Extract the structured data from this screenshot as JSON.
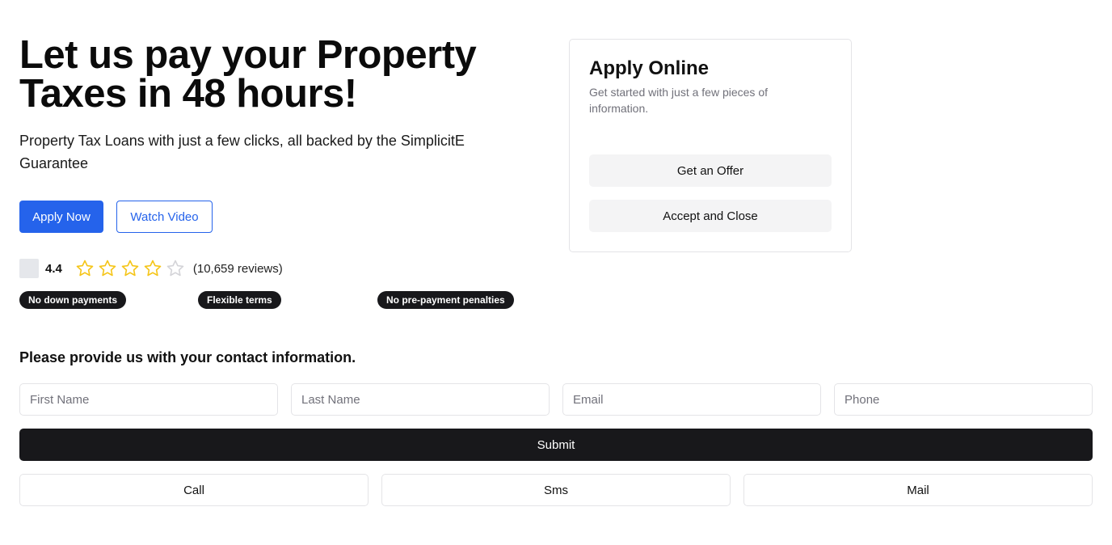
{
  "hero": {
    "title": "Let us pay your Property Taxes in 48 hours!",
    "subtitle": "Property Tax Loans with just a few clicks, all backed by the SimplicitE Guarantee",
    "apply_label": "Apply Now",
    "watch_label": "Watch Video"
  },
  "rating": {
    "value": "4.4",
    "stars": [
      "filled",
      "filled",
      "filled",
      "filled",
      "empty"
    ],
    "reviews": "(10,659 reviews)",
    "star_color": "#f5c518",
    "empty_star_color": "#d4d4d8"
  },
  "badges": [
    "No down payments",
    "Flexible terms",
    "No pre-payment penalties"
  ],
  "card": {
    "title": "Apply Online",
    "subtitle": "Get started with just a few pieces of information.",
    "offer_label": "Get an Offer",
    "accept_label": "Accept and Close"
  },
  "contact": {
    "heading": "Please provide us with your contact information.",
    "first_name_placeholder": "First Name",
    "last_name_placeholder": "Last Name",
    "email_placeholder": "Email",
    "phone_placeholder": "Phone",
    "submit_label": "Submit",
    "call_label": "Call",
    "sms_label": "Sms",
    "mail_label": "Mail"
  },
  "colors": {
    "primary": "#2563eb",
    "dark": "#18181b"
  }
}
